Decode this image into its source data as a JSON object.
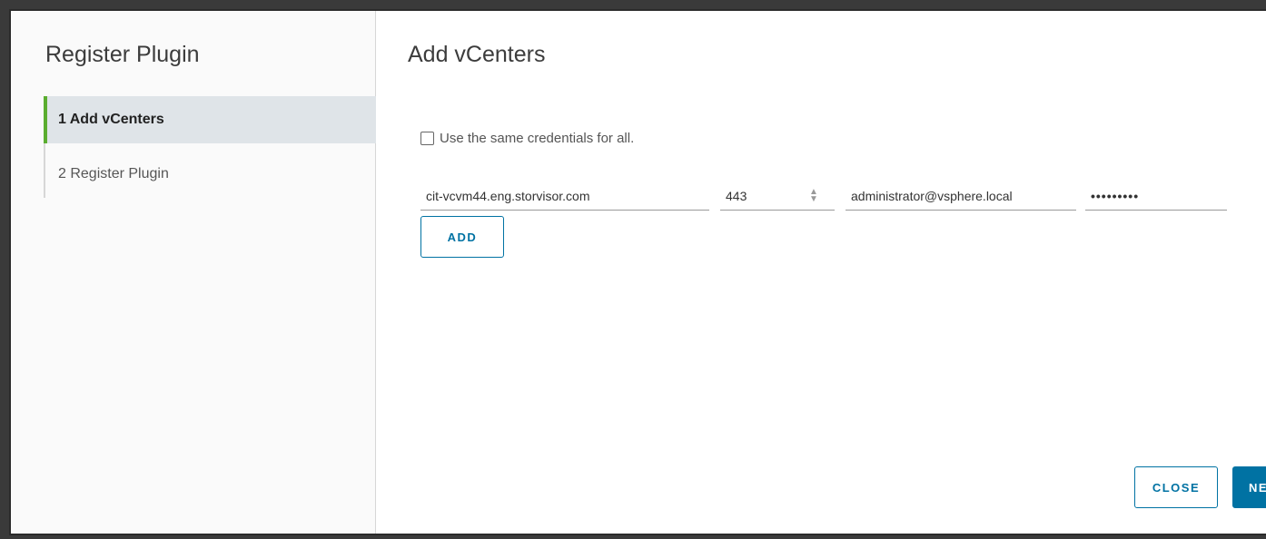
{
  "nav": {
    "title": "Register Plugin",
    "steps": [
      {
        "label": "1 Add vCenters",
        "active": true
      },
      {
        "label": "2 Register Plugin",
        "active": false
      }
    ]
  },
  "main": {
    "title": "Add vCenters",
    "same_credentials_label": "Use the same credentials for all.",
    "same_credentials_checked": false,
    "vcenter": {
      "host": "cit-vcvm44.eng.storvisor.com",
      "port": "443",
      "username": "administrator@vsphere.local",
      "password": "•••••••••"
    },
    "add_label": "ADD"
  },
  "footer": {
    "close_label": "CLOSE",
    "next_label": "NE"
  },
  "colors": {
    "accent": "#0072a3",
    "active_step": "#5aad2f"
  }
}
